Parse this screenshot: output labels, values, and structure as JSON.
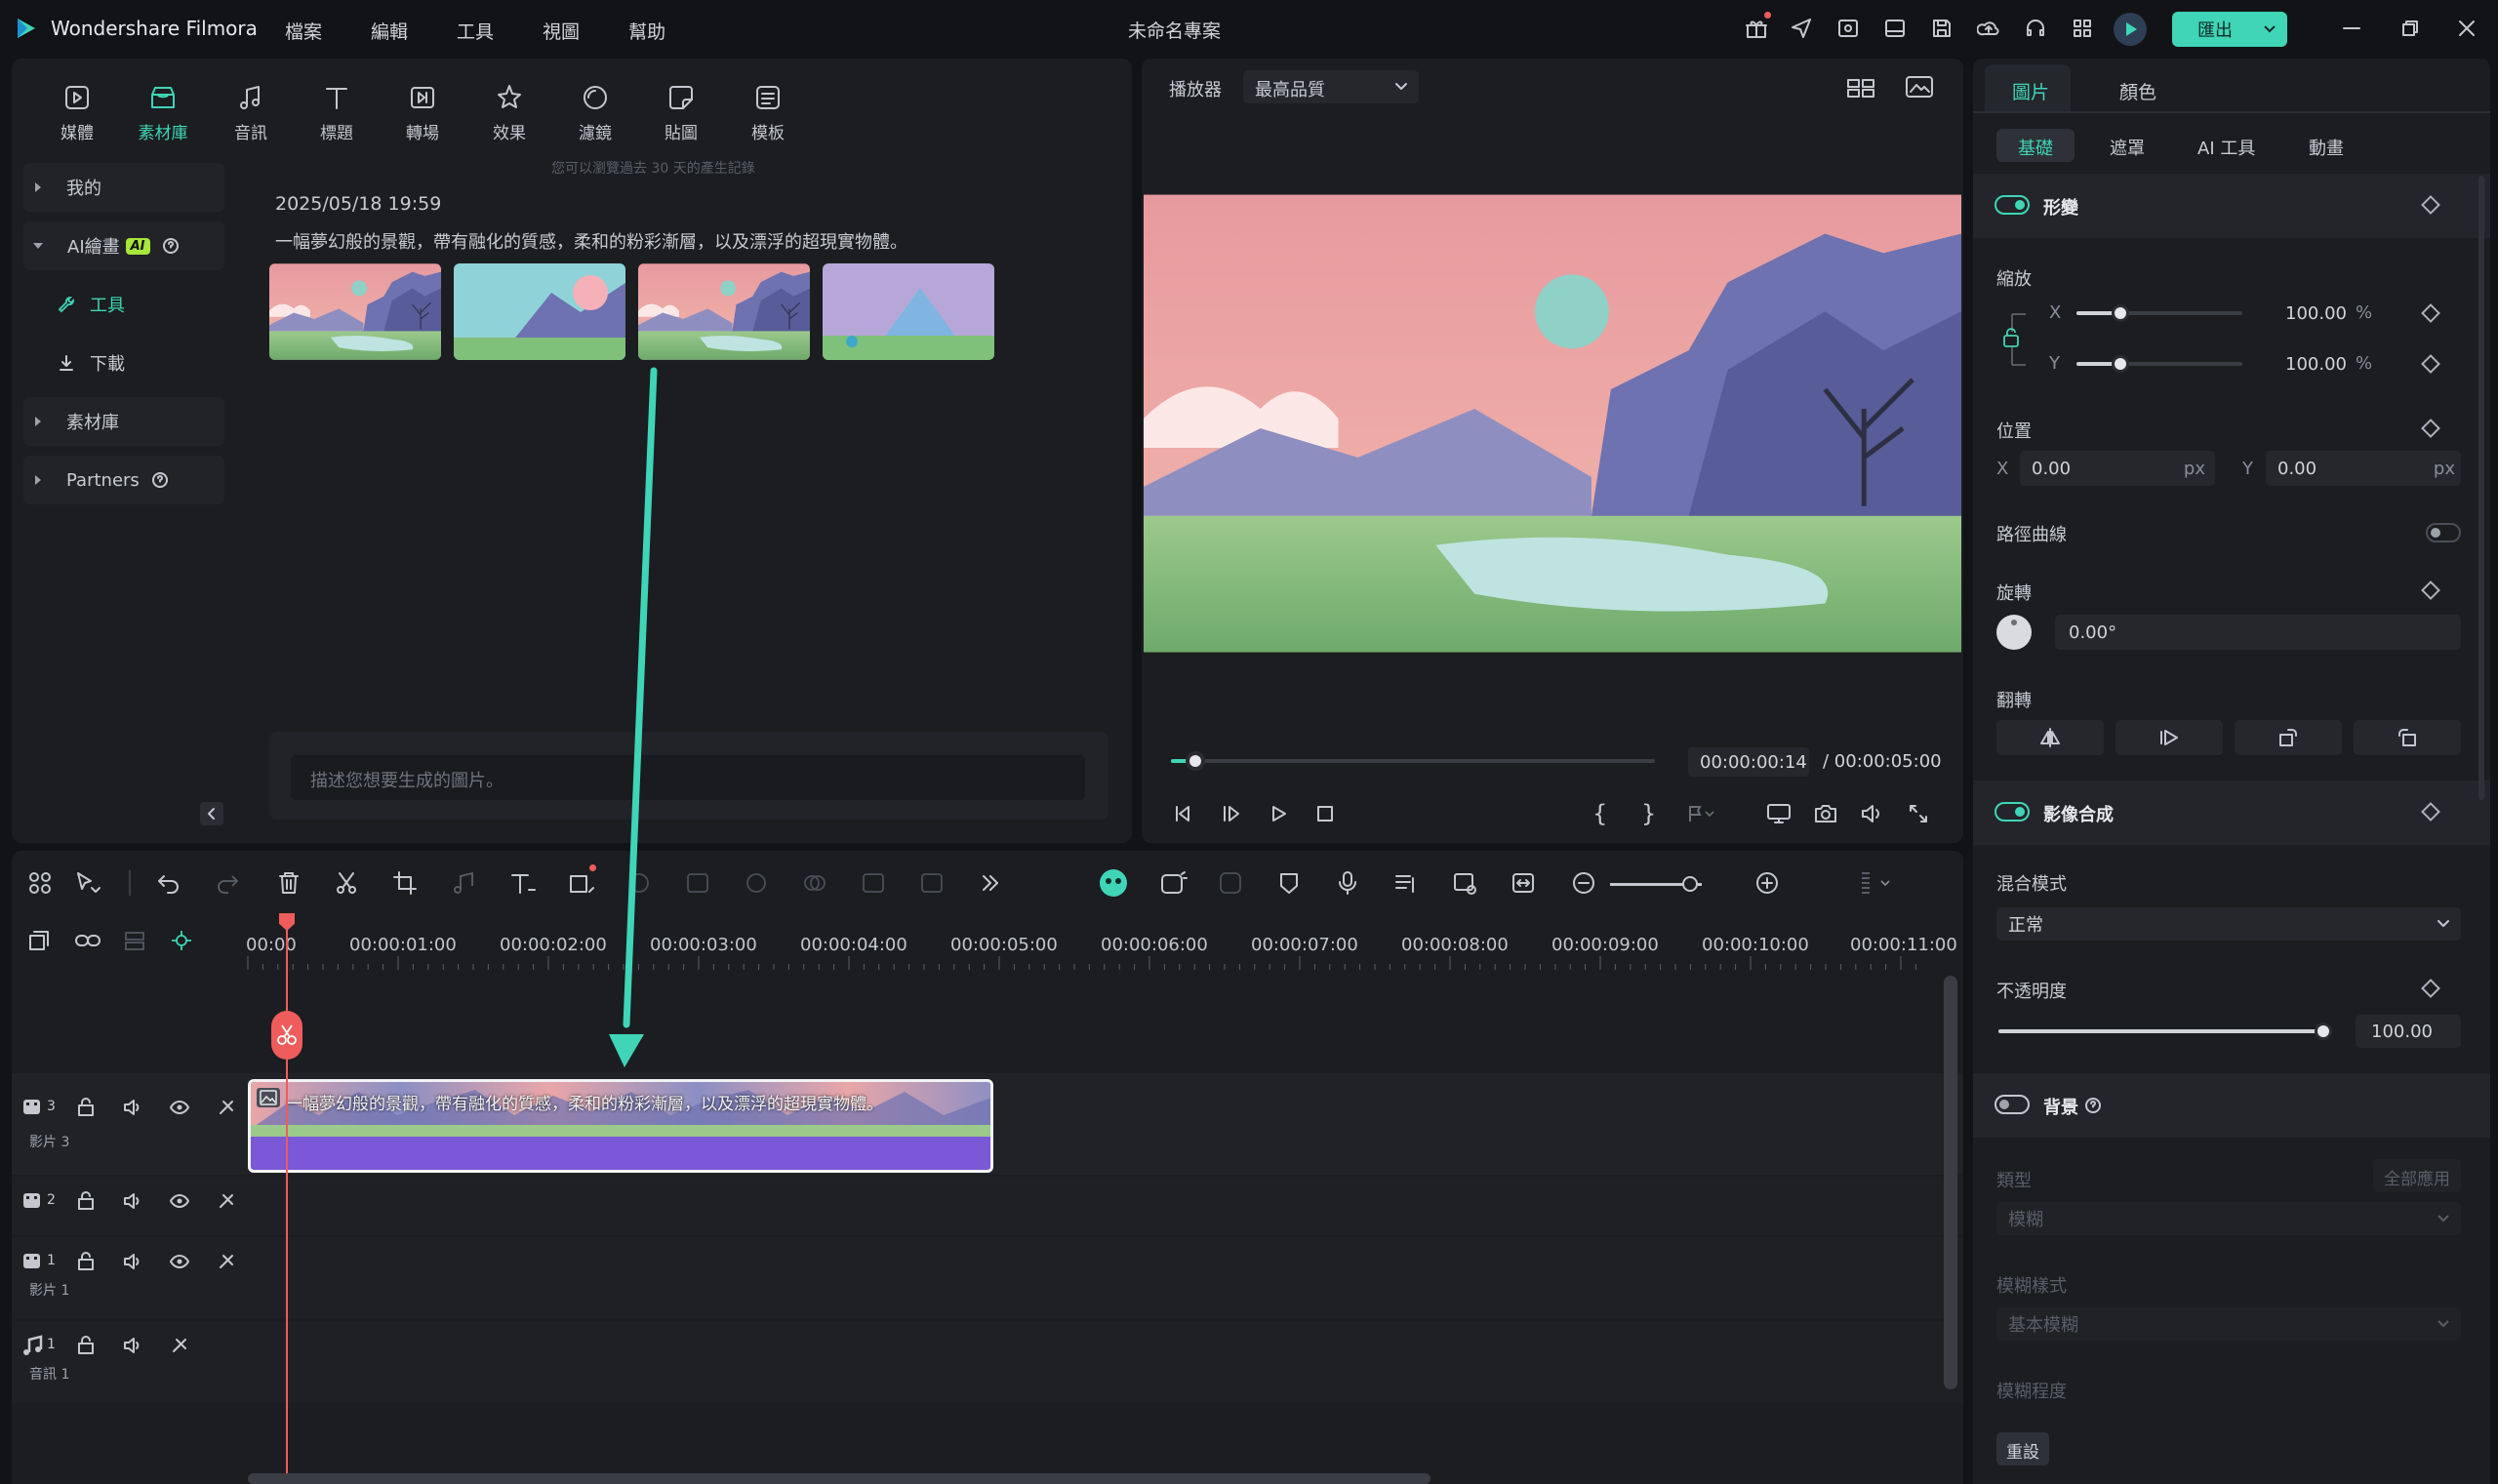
{
  "app": {
    "name": "Wondershare Filmora",
    "project_title": "未命名專案"
  },
  "menu": [
    "檔案",
    "編輯",
    "工具",
    "視圖",
    "幫助"
  ],
  "export_label": "匯出",
  "tool_tabs": [
    {
      "label": "媒體",
      "icon": "media-icon"
    },
    {
      "label": "素材庫",
      "icon": "library-icon"
    },
    {
      "label": "音訊",
      "icon": "music-note-icon"
    },
    {
      "label": "標題",
      "icon": "title-t-icon"
    },
    {
      "label": "轉場",
      "icon": "transition-icon"
    },
    {
      "label": "效果",
      "icon": "effects-icon"
    },
    {
      "label": "濾鏡",
      "icon": "filter-icon"
    },
    {
      "label": "貼圖",
      "icon": "sticker-icon"
    },
    {
      "label": "模板",
      "icon": "template-icon"
    }
  ],
  "sidebar": {
    "mine": "我的",
    "ai_image": "AI繪畫",
    "ai_badge": "AI",
    "tools": "工具",
    "download": "下載",
    "library": "素材庫",
    "partners": "Partners"
  },
  "library": {
    "history_note": "您可以瀏覽過去 30 天的產生記錄",
    "timestamp": "2025/05/18 19:59",
    "prompt": "一幅夢幻般的景觀，帶有融化的質感，柔和的粉彩漸層，以及漂浮的超現實物體。",
    "input_placeholder": "描述您想要生成的圖片。"
  },
  "player": {
    "label": "播放器",
    "quality": "最高品質",
    "current_time": "00:00:00:14",
    "total_time": "/ 00:00:05:00",
    "progress": 0.05
  },
  "right_panel": {
    "tabs": [
      "圖片",
      "顏色"
    ],
    "subtabs": [
      "基礎",
      "遮罩",
      "AI 工具",
      "動畫"
    ],
    "transform": "形變",
    "scale": "縮放",
    "scale_x": "100.00",
    "scale_y": "100.00",
    "percent": "%",
    "x": "X",
    "y": "Y",
    "position": "位置",
    "pos_x": "0.00",
    "pos_y": "0.00",
    "px": "px",
    "path_curve": "路徑曲線",
    "rotate": "旋轉",
    "rotate_value": "0.00°",
    "flip": "翻轉",
    "compositing": "影像合成",
    "blend_mode": "混合模式",
    "blend_value": "正常",
    "opacity": "不透明度",
    "opacity_value": "100.00",
    "background": "背景",
    "type": "類型",
    "apply_all": "全部應用",
    "type_value": "模糊",
    "blur_style": "模糊樣式",
    "blur_style_value": "基本模糊",
    "blur_degree": "模糊程度",
    "reset": "重設"
  },
  "timeline": {
    "ruler": [
      "00:00",
      "00:00:01:00",
      "00:00:02:00",
      "00:00:03:00",
      "00:00:04:00",
      "00:00:05:00",
      "00:00:06:00",
      "00:00:07:00",
      "00:00:08:00",
      "00:00:09:00",
      "00:00:10:00",
      "00:00:11:00"
    ],
    "clip_title": "一幅夢幻般的景觀，帶有融化的質感，柔和的粉彩漸層，以及漂浮的超現實物體。",
    "tracks": [
      {
        "num": "3",
        "name": "影片 3"
      },
      {
        "num": "2",
        "name": ""
      },
      {
        "num": "1",
        "name": "影片 1"
      },
      {
        "num": "1",
        "name": "音訊 1"
      }
    ]
  },
  "colors": {
    "accent": "#3fd5b6",
    "playhead": "#f05c5c",
    "clip_audio": "#7a58d6",
    "bg": "#121316",
    "panel": "#1b1d21"
  }
}
